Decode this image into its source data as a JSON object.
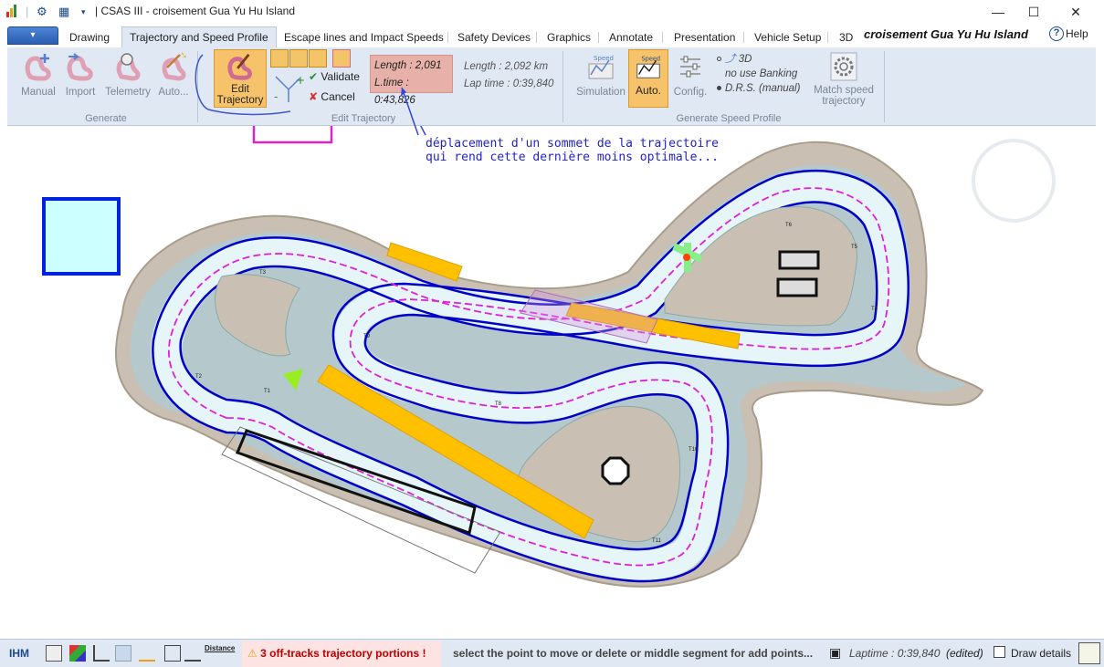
{
  "window": {
    "title": "| CSAS III - croisement Gua Yu Hu Island",
    "minimize": "—",
    "maximize": "☐",
    "close": "✕"
  },
  "menu": {
    "file_label": "▾",
    "tabs": [
      "Drawing",
      "Trajectory and Speed Profile",
      "Escape lines and Impact Speeds",
      "Safety Devices",
      "Graphics",
      "Annotate",
      "Presentation",
      "Vehicle Setup",
      "3D"
    ],
    "active_tab": "Trajectory and Speed Profile",
    "track_title": "croisement Gua Yu Hu Island",
    "help": "Help"
  },
  "ribbon": {
    "generate": {
      "buttons": [
        "Manual",
        "Import",
        "Telemetry",
        "Auto..."
      ],
      "label": "Generate"
    },
    "edit_trajectory": {
      "button_line1": "Edit",
      "button_line2": "Trajectory",
      "validate": "Validate",
      "cancel": "Cancel",
      "length_value": "Length : 2,091",
      "ltime_value": "L.time : 0:43,826",
      "label": "Edit Trajectory"
    },
    "length_info": {
      "length": "Length : 2,092 km",
      "lap_time": "Lap time : 0:39,840"
    },
    "speed_profile": {
      "simulation": "Simulation",
      "auto": "Auto.",
      "config": "Config.",
      "opt_3d": "3D",
      "opt_banking": "no use Banking",
      "opt_drs": "D.R.S. (manual)",
      "match_line1": "Match speed",
      "match_line2": "trajectory",
      "label": "Generate Speed Profile",
      "icon_text_speed": "Speed"
    }
  },
  "canvas": {
    "annotation_line1": "déplacement d'un sommet de la trajectoire",
    "annotation_line2": "qui rend cette dernière moins optimale...",
    "turn_labels": [
      "T3",
      "T2",
      "T1",
      "T9",
      "T8",
      "T5",
      "T6",
      "T4",
      "T10",
      "T11"
    ]
  },
  "status": {
    "ihm": "IHM",
    "distance_label": "Distance",
    "warning": "3 off-tracks trajectory portions !",
    "hint": "select the point to move or delete or middle segment for add points...",
    "laptime": "Laptime : 0:39,840",
    "edited": "(edited)",
    "draw_details": "Draw details"
  },
  "colors": {
    "accent": "#2a5fb3",
    "ribbon_bg": "#dfe8f3",
    "highlight": "#f7c36a",
    "warning": "#c00000",
    "track": "#0000c8",
    "runoff": "#b5c9cc"
  }
}
